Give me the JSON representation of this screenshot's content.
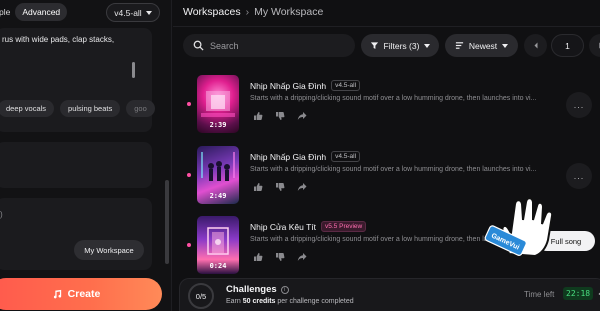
{
  "left": {
    "mode_simple": "ple",
    "mode_advanced": "Advanced",
    "version": "v4.5-all",
    "style_text": "rus with wide pads, clap stacks,",
    "tags": [
      "deep vocals",
      "pulsing beats",
      "goo"
    ],
    "box3_hint": ")",
    "workspace_button": "My Workspace",
    "create_button": "Create"
  },
  "right": {
    "breadcrumb": {
      "root": "Workspaces",
      "sep": "›",
      "current": "My Workspace"
    },
    "search_placeholder": "Search",
    "filters_label": "Filters (3)",
    "sort_label": "Newest",
    "page_number": "1",
    "songs": [
      {
        "title": "Nhịp Nhấp Gia Đình",
        "version": "v4.5-all",
        "preview": false,
        "duration": "2:39",
        "desc": "Starts with a dripping/clicking sound motif over a low humming drone, then launches into vi..."
      },
      {
        "title": "Nhịp Nhấp Gia Đình",
        "version": "v4.5-all",
        "preview": false,
        "duration": "2:49",
        "desc": "Starts with a dripping/clicking sound motif over a low humming drone, then launches into vi..."
      },
      {
        "title": "Nhịp Cửa Kêu Tít",
        "version": "v5.5 Preview",
        "preview": true,
        "duration": "0:24",
        "desc": "Starts with a dripping/clicking sound motif over a low humming drone, then launches into vi..."
      }
    ],
    "more_label": "...",
    "full_song_label": "Full song",
    "watermark": "GameVui",
    "challenges": {
      "progress": "0/5",
      "title": "Challenges",
      "info": "i",
      "sub_prefix": "Earn",
      "sub_bold": "50 credits",
      "sub_suffix": "per challenge completed",
      "time_label": "Time left",
      "time_value": "22:18"
    }
  },
  "colors": {
    "accent_pink": "#ff4fa3",
    "create_gradient_start": "#ff5a4d",
    "create_gradient_end": "#ff8a58",
    "timer_green": "#4ade80"
  }
}
